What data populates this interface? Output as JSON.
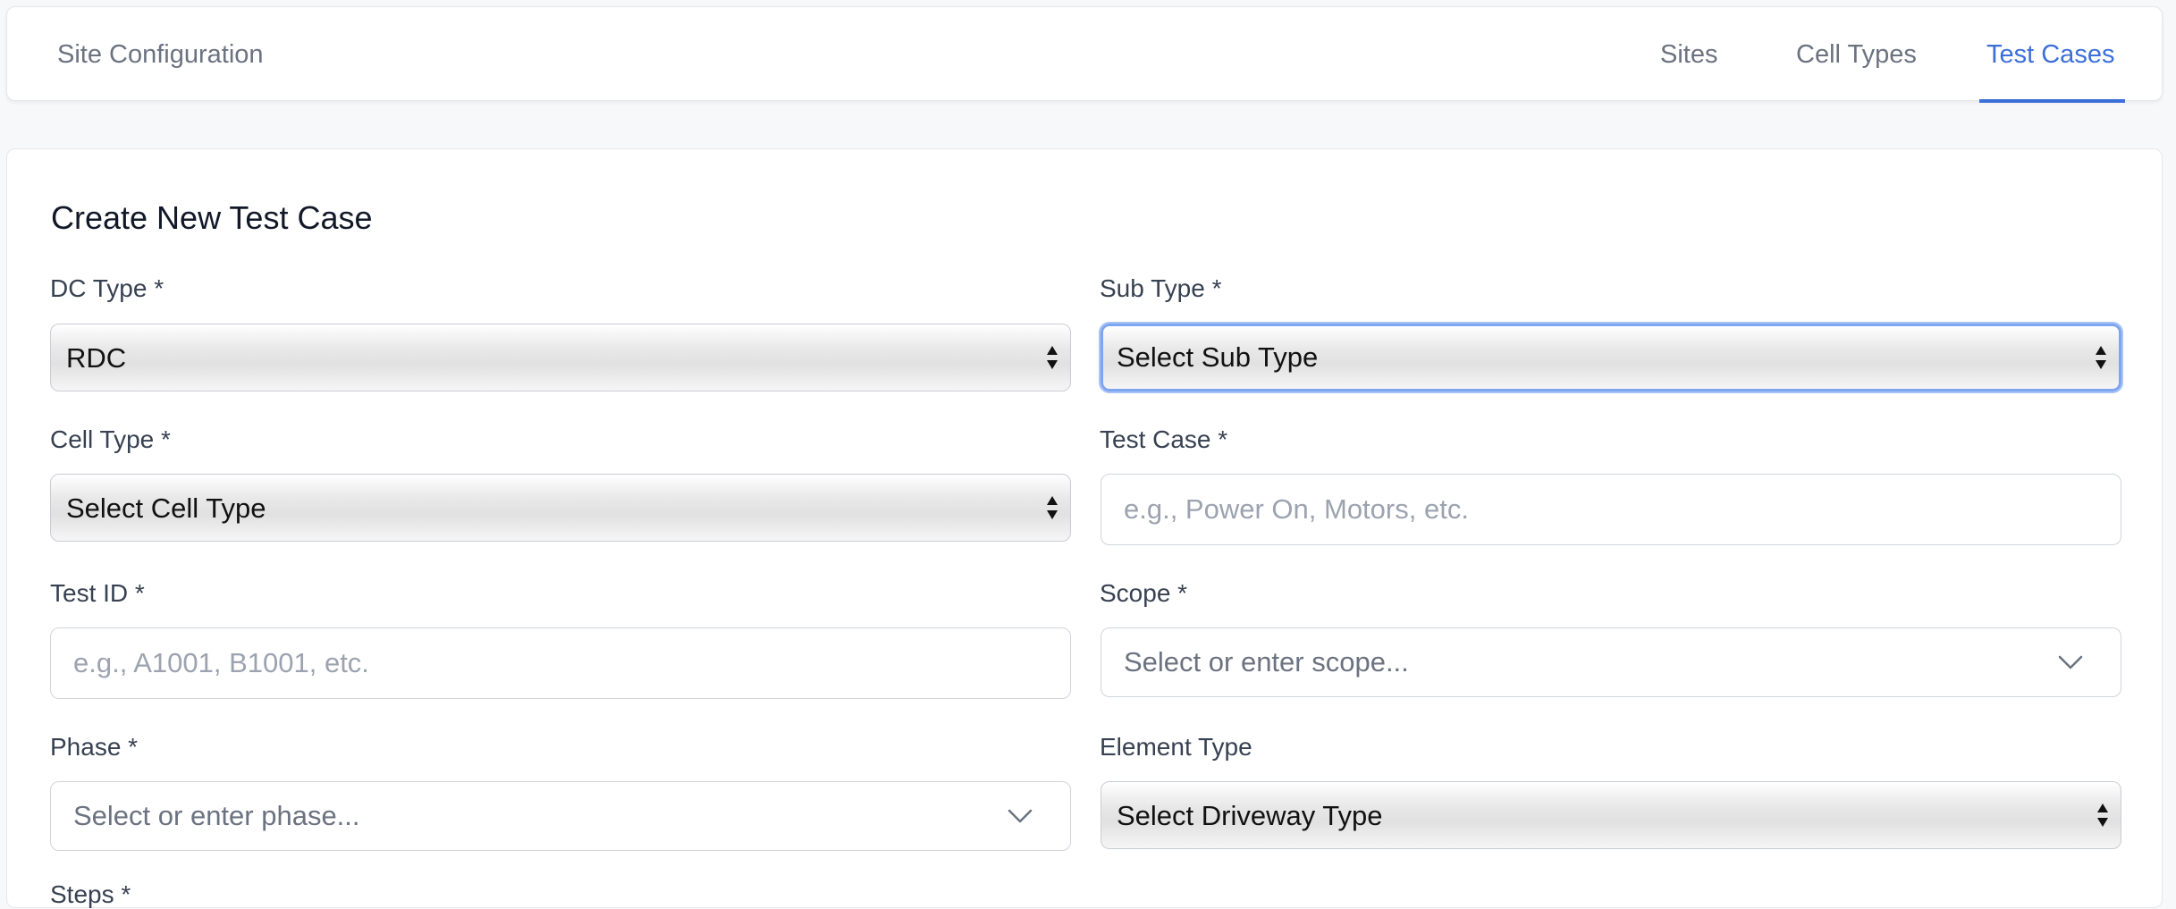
{
  "header": {
    "brand": "Site Configuration",
    "nav": [
      {
        "label": "Sites",
        "active": false
      },
      {
        "label": "Cell Types",
        "active": false
      },
      {
        "label": "Test Cases",
        "active": true
      }
    ]
  },
  "form": {
    "title": "Create New Test Case",
    "dc_type": {
      "label": "DC Type *",
      "value": "RDC"
    },
    "sub_type": {
      "label": "Sub Type *",
      "value": "Select Sub Type"
    },
    "cell_type": {
      "label": "Cell Type *",
      "value": "Select Cell Type"
    },
    "test_case": {
      "label": "Test Case *",
      "placeholder": "e.g., Power On, Motors, etc."
    },
    "test_id": {
      "label": "Test ID *",
      "placeholder": "e.g., A1001, B1001, etc."
    },
    "scope": {
      "label": "Scope *",
      "placeholder": "Select or enter scope..."
    },
    "phase": {
      "label": "Phase *",
      "placeholder": "Select or enter phase..."
    },
    "element_type": {
      "label": "Element Type",
      "value": "Select Driveway Type"
    },
    "next_label": "Steps *"
  },
  "colors": {
    "accent": "#3b6fd8",
    "focus_ring": "#7ea6f0"
  }
}
